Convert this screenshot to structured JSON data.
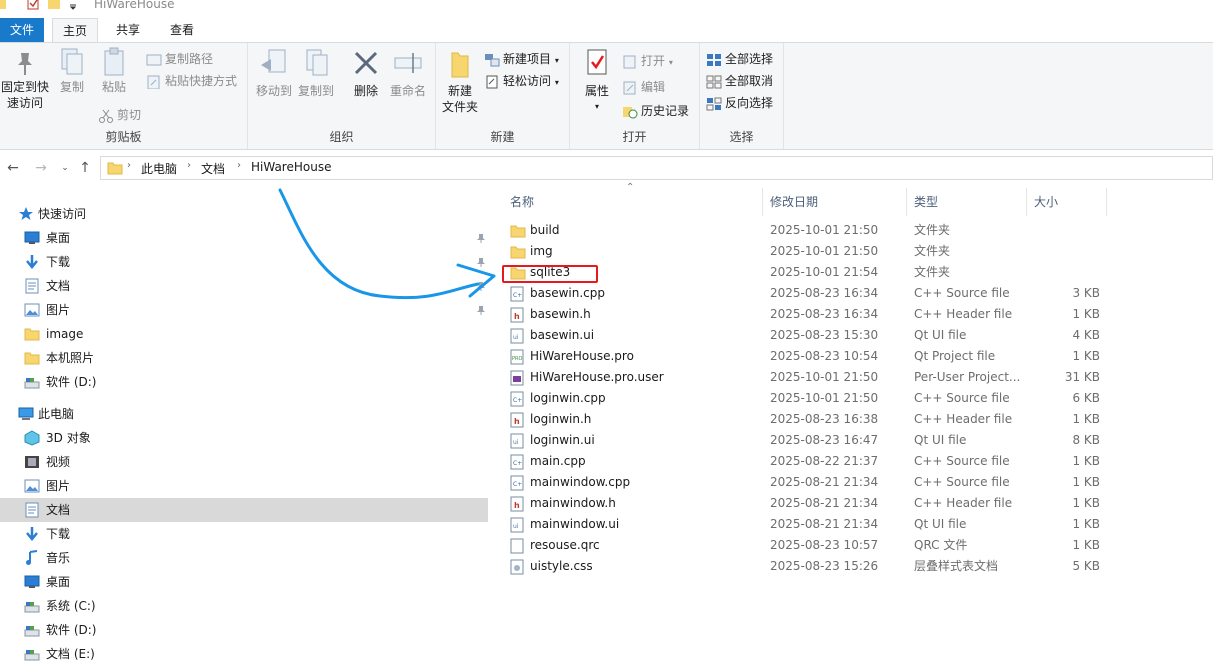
{
  "window": {
    "title": "HiWareHouse"
  },
  "ribbon_tabs": [
    {
      "label": "文件"
    },
    {
      "label": "主页"
    },
    {
      "label": "共享"
    },
    {
      "label": "查看"
    }
  ],
  "ribbon": {
    "clipboard": {
      "pin_label_1": "固定到快",
      "pin_label_2": "速访问",
      "copy": "复制",
      "paste": "粘贴",
      "copy_path": "复制路径",
      "paste_shortcut": "粘贴快捷方式",
      "cut": "剪切",
      "group": "剪贴板"
    },
    "organize": {
      "move_to": "移动到",
      "copy_to": "复制到",
      "delete": "删除",
      "rename": "重命名",
      "group": "组织"
    },
    "new": {
      "new_folder_1": "新建",
      "new_folder_2": "文件夹",
      "new_item": "新建项目",
      "easy_access": "轻松访问",
      "group": "新建"
    },
    "open": {
      "properties": "属性",
      "open": "打开",
      "edit": "编辑",
      "history": "历史记录",
      "group": "打开"
    },
    "select": {
      "select_all": "全部选择",
      "select_none": "全部取消",
      "invert": "反向选择",
      "group": "选择"
    }
  },
  "address": {
    "crumbs": [
      "此电脑",
      "文档",
      "HiWareHouse"
    ]
  },
  "nav": {
    "quick_access": "快速访问",
    "quick_items": [
      {
        "label": "桌面",
        "icon": "desktop-icon"
      },
      {
        "label": "下载",
        "icon": "download-icon"
      },
      {
        "label": "文档",
        "icon": "document-icon"
      },
      {
        "label": "图片",
        "icon": "picture-icon"
      },
      {
        "label": "image",
        "icon": "folder-icon"
      },
      {
        "label": "本机照片",
        "icon": "folder-icon"
      },
      {
        "label": "软件 (D:)",
        "icon": "drive-icon"
      }
    ],
    "this_pc": "此电脑",
    "pc_items": [
      {
        "label": "3D 对象",
        "icon": "3d-objects-icon"
      },
      {
        "label": "视频",
        "icon": "video-icon"
      },
      {
        "label": "图片",
        "icon": "picture-icon"
      },
      {
        "label": "文档",
        "icon": "document-icon"
      },
      {
        "label": "下载",
        "icon": "download-icon"
      },
      {
        "label": "音乐",
        "icon": "music-icon"
      },
      {
        "label": "桌面",
        "icon": "desktop-icon"
      },
      {
        "label": "系统 (C:)",
        "icon": "drive-icon"
      },
      {
        "label": "软件 (D:)",
        "icon": "drive-icon"
      },
      {
        "label": "文档 (E:)",
        "icon": "drive-icon"
      }
    ]
  },
  "columns": {
    "name": "名称",
    "date": "修改日期",
    "type": "类型",
    "size": "大小"
  },
  "files": [
    {
      "name": "build",
      "date": "2025-10-01 21:50",
      "type": "文件夹",
      "size": "",
      "icon": "folder-icon"
    },
    {
      "name": "img",
      "date": "2025-10-01 21:50",
      "type": "文件夹",
      "size": "",
      "icon": "folder-icon"
    },
    {
      "name": "sqlite3",
      "date": "2025-10-01 21:54",
      "type": "文件夹",
      "size": "",
      "icon": "folder-icon"
    },
    {
      "name": "basewin.cpp",
      "date": "2025-08-23 16:34",
      "type": "C++ Source file",
      "size": "3 KB",
      "icon": "cpp-file-icon"
    },
    {
      "name": "basewin.h",
      "date": "2025-08-23 16:34",
      "type": "C++ Header file",
      "size": "1 KB",
      "icon": "header-file-icon"
    },
    {
      "name": "basewin.ui",
      "date": "2025-08-23 15:30",
      "type": "Qt UI file",
      "size": "4 KB",
      "icon": "ui-file-icon"
    },
    {
      "name": "HiWareHouse.pro",
      "date": "2025-08-23 10:54",
      "type": "Qt Project file",
      "size": "1 KB",
      "icon": "pro-file-icon"
    },
    {
      "name": "HiWareHouse.pro.user",
      "date": "2025-10-01 21:50",
      "type": "Per-User Project...",
      "size": "31 KB",
      "icon": "user-file-icon"
    },
    {
      "name": "loginwin.cpp",
      "date": "2025-10-01 21:50",
      "type": "C++ Source file",
      "size": "6 KB",
      "icon": "cpp-file-icon"
    },
    {
      "name": "loginwin.h",
      "date": "2025-08-23 16:38",
      "type": "C++ Header file",
      "size": "1 KB",
      "icon": "header-file-icon"
    },
    {
      "name": "loginwin.ui",
      "date": "2025-08-23 16:47",
      "type": "Qt UI file",
      "size": "8 KB",
      "icon": "ui-file-icon"
    },
    {
      "name": "main.cpp",
      "date": "2025-08-22 21:37",
      "type": "C++ Source file",
      "size": "1 KB",
      "icon": "cpp-file-icon"
    },
    {
      "name": "mainwindow.cpp",
      "date": "2025-08-21 21:34",
      "type": "C++ Source file",
      "size": "1 KB",
      "icon": "cpp-file-icon"
    },
    {
      "name": "mainwindow.h",
      "date": "2025-08-21 21:34",
      "type": "C++ Header file",
      "size": "1 KB",
      "icon": "header-file-icon"
    },
    {
      "name": "mainwindow.ui",
      "date": "2025-08-21 21:34",
      "type": "Qt UI file",
      "size": "1 KB",
      "icon": "ui-file-icon"
    },
    {
      "name": "resouse.qrc",
      "date": "2025-08-23 10:57",
      "type": "QRC 文件",
      "size": "1 KB",
      "icon": "blank-file-icon"
    },
    {
      "name": "uistyle.css",
      "date": "2025-08-23 15:26",
      "type": "层叠样式表文档",
      "size": "5 KB",
      "icon": "css-file-icon"
    }
  ],
  "colors": {
    "accent": "#1979ca",
    "folder": "#f8d66f",
    "annotation_arrow": "#1a96e8",
    "annotation_box": "#e5191e",
    "selected_nav": "#d9d9d9"
  }
}
